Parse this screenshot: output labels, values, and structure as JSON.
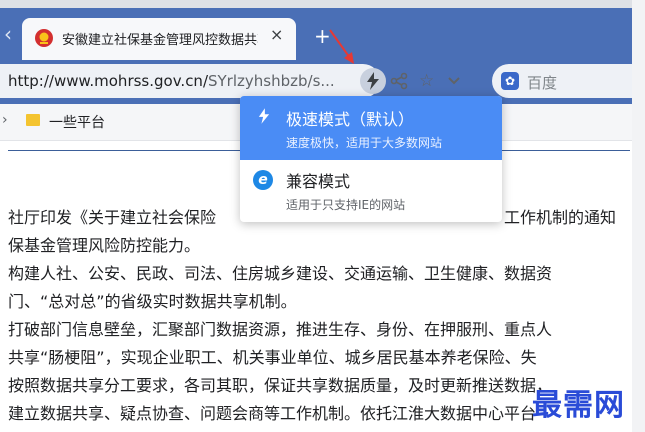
{
  "browser": {
    "tab": {
      "title": "安徽建立社保基金管理风控数据共享机制",
      "close_glyph": "×"
    },
    "new_tab_glyph": "+",
    "address": {
      "url_host": "http://www.mohrss.gov.cn/",
      "url_rest": "SYrlzyhshbzb/s..."
    },
    "search": {
      "placeholder": "百度"
    },
    "bookmarks": [
      {
        "label": "一些平台"
      }
    ]
  },
  "mode_menu": {
    "items": [
      {
        "title": "极速模式（默认）",
        "desc": "速度极快，适用于大多数网站",
        "icon": "lightning-icon"
      },
      {
        "title": "兼容模式",
        "desc": "适用于只支持IE的网站",
        "icon": "ie-icon"
      }
    ]
  },
  "article": {
    "lines": [
      "社厅印发《关于建立社会保险",
      "工作机制的通知",
      "保基金管理风险防控能力。",
      "构建人社、公安、民政、司法、住房城乡建设、交通运输、卫生健康、数据资",
      "门、“总对总”的省级实时数据共享机制。",
      "打破部门信息壁垒，汇聚部门数据资源，推进生存、身份、在押服刑、重点人",
      "共享“肠梗阻”，实现企业职工、机关事业单位、城乡居民基本养老保险、失",
      "按照数据共享分工要求，各司其职，保证共享数据质量，及时更新推送数据，",
      "建立数据共享、疑点协查、问题会商等工作机制。依托江淮大数据中心平台"
    ]
  },
  "watermark": "最需网",
  "colors": {
    "accent": "#4a6fb6",
    "menu_highlight": "#4a8cf5",
    "arrow": "#e53935"
  }
}
